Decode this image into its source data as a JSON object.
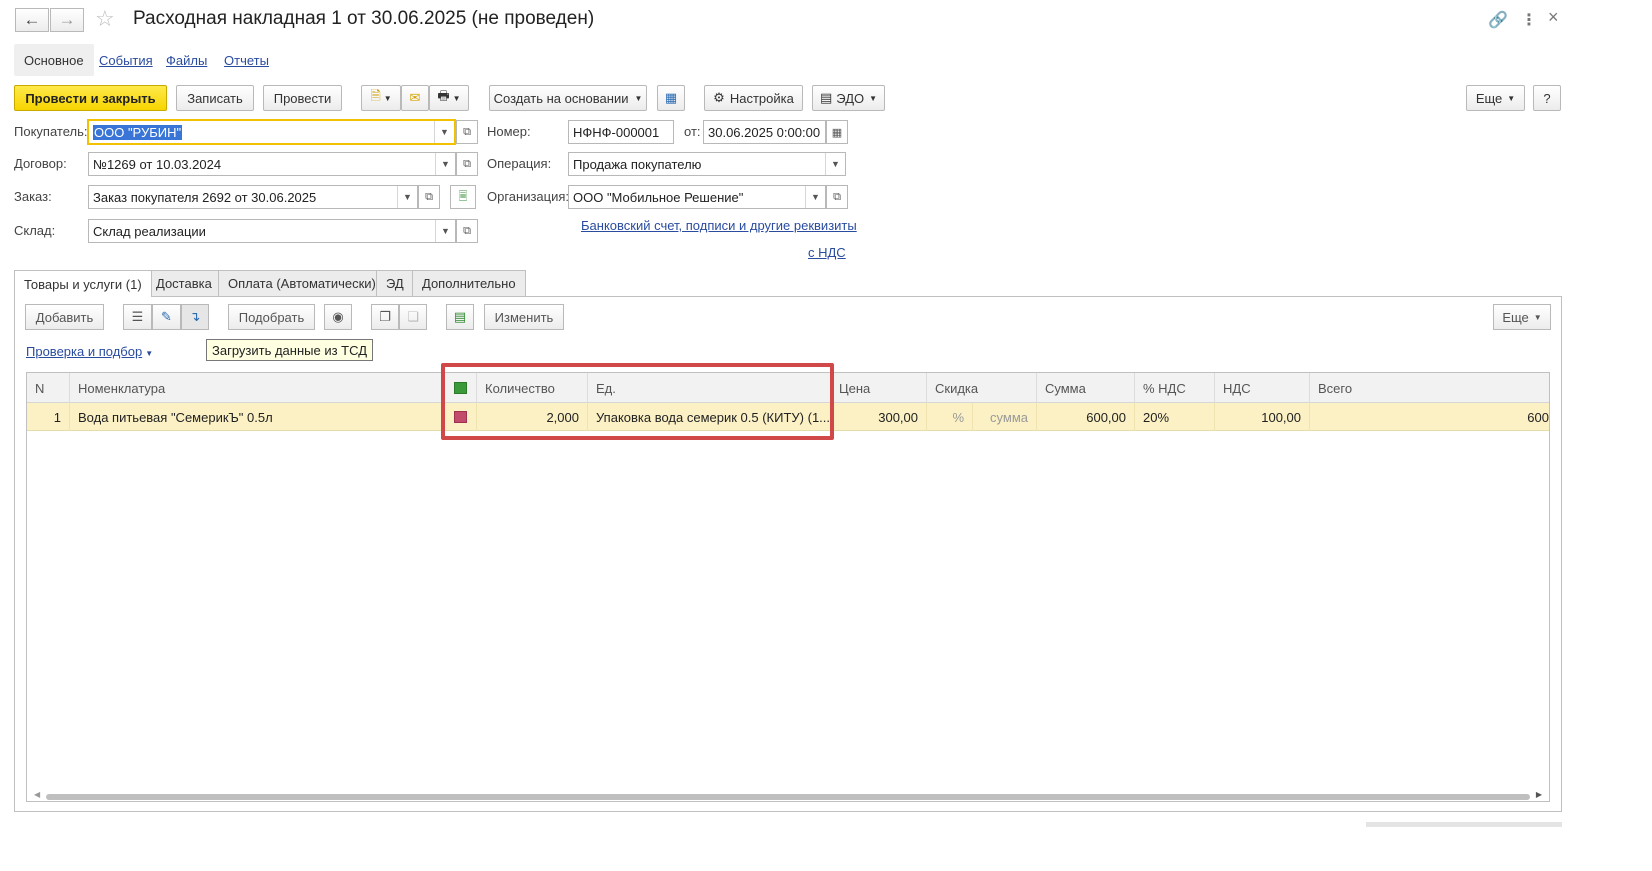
{
  "window": {
    "title": "Расходная накладная 1 от 30.06.2025 (не проведен)",
    "back_icon": "arrow-left-icon",
    "forward_icon": "arrow-right-icon",
    "favorite_icon": "star-icon",
    "link_icon": "link-icon",
    "menu_icon": "more-vertical-icon",
    "close_icon": "close-icon"
  },
  "nav_tabs": [
    {
      "label": "Основное"
    },
    {
      "label": "События"
    },
    {
      "label": "Файлы"
    },
    {
      "label": "Отчеты"
    }
  ],
  "toolbar": {
    "post_close": "Провести и закрыть",
    "save": "Записать",
    "post": "Провести",
    "create_based": "Создать на основании",
    "settings": "Настройка",
    "edo": "ЭДО",
    "more": "Еще",
    "help": "?"
  },
  "form": {
    "buyer_label": "Покупатель:",
    "buyer_value": "ООО \"РУБИН\"",
    "contract_label": "Договор:",
    "contract_value": "№1269 от 10.03.2024",
    "order_label": "Заказ:",
    "order_value": "Заказ покупателя 2692 от 30.06.2025",
    "warehouse_label": "Склад:",
    "warehouse_value": "Склад реализации",
    "number_label": "Номер:",
    "number_value": "НФНФ-000001",
    "date_label": "от:",
    "date_value": "30.06.2025  0:00:00",
    "operation_label": "Операция:",
    "operation_value": "Продажа покупателю",
    "org_label": "Организация:",
    "org_value": "ООО \"Мобильное Решение\"",
    "bank_link": "Банковский счет, подписи и другие реквизиты",
    "vat_link": "с НДС"
  },
  "doc_tabs": [
    {
      "label": "Товары и услуги (1)"
    },
    {
      "label": "Доставка"
    },
    {
      "label": "Оплата (Автоматически)"
    },
    {
      "label": "ЭД"
    },
    {
      "label": "Дополнительно"
    }
  ],
  "items_toolbar": {
    "add": "Добавить",
    "pick": "Подобрать",
    "change": "Изменить",
    "more": "Еще",
    "check_link": "Проверка и подбор",
    "tooltip": "Загрузить данные из ТСД"
  },
  "table": {
    "columns": [
      "N",
      "Номенклатура",
      "",
      "Количество",
      "Ед.",
      "Цена",
      "Скидка",
      "",
      "Сумма",
      "% НДС",
      "НДС",
      "Всего"
    ],
    "rows": [
      {
        "n": "1",
        "item": "Вода питьевая \"СемерикЪ\" 0.5л",
        "qty": "2,000",
        "unit": "Упаковка вода семерик 0.5 (КИТУ) (1...",
        "price": "300,00",
        "discount_pct": "%",
        "discount_sum": "сумма",
        "sum": "600,00",
        "vat_rate": "20%",
        "vat": "100,00",
        "total": "600"
      }
    ]
  },
  "colors": {
    "primary_button": "#f7d500",
    "row_highlight": "#fbf1c4",
    "link": "#2a4c9f",
    "annotation": "#d04848"
  }
}
